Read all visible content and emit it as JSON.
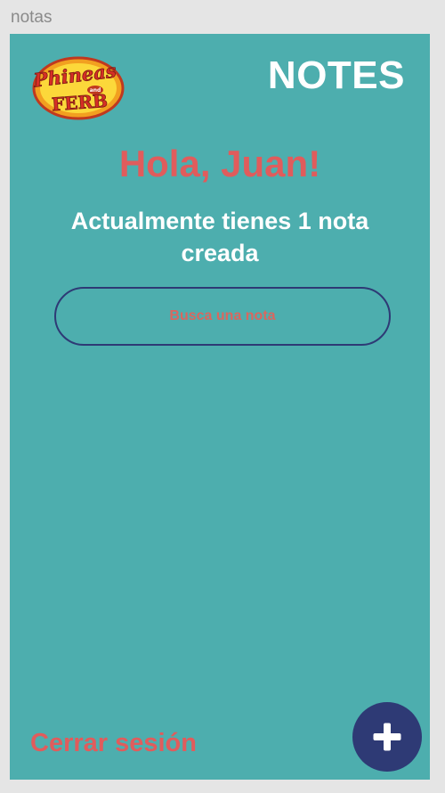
{
  "frame": {
    "label": "notas"
  },
  "header": {
    "logo_alt": "Phineas and Ferb",
    "title": "NOTES"
  },
  "main": {
    "greeting": "Hola, Juan!",
    "note_count_text": "Actualmente tienes 1 nota creada",
    "search": {
      "placeholder": "Busca una nota",
      "value": ""
    }
  },
  "footer": {
    "logout_label": "Cerrar sesión",
    "add_button_icon": "plus-icon"
  },
  "colors": {
    "background": "#4daeae",
    "accent_red": "#e05c5c",
    "navy": "#2e3a75",
    "white": "#ffffff"
  }
}
